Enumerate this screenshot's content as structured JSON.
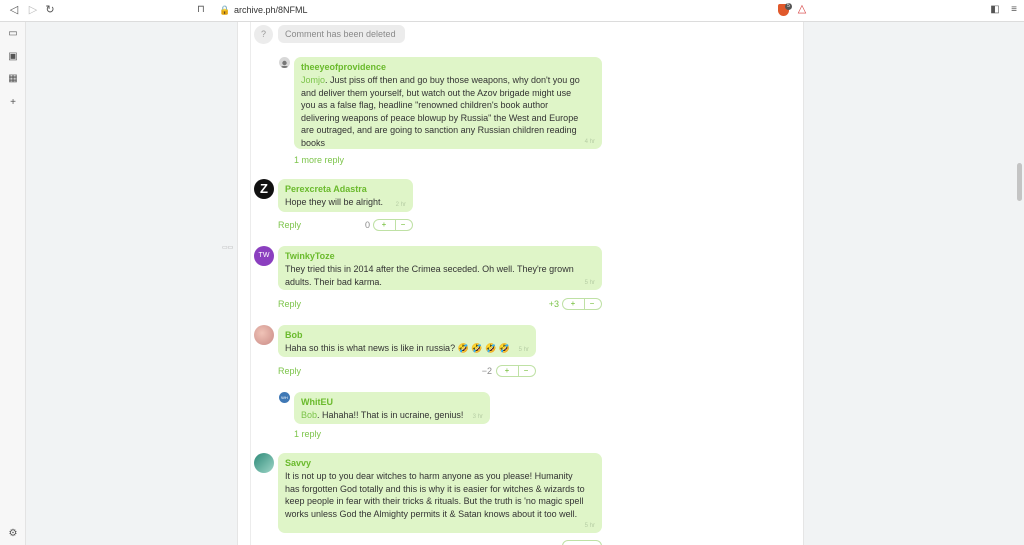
{
  "browser": {
    "url": "archive.ph/8NFML",
    "extension_badge": "5"
  },
  "comments": {
    "deleted_placeholder": {
      "avatar_text": "?",
      "text": "Comment has been deleted"
    },
    "c1": {
      "author": "theeyeofprovidence",
      "mention": "Jomjo",
      "lines": [
        ". Just piss off then and go buy those weapons, why don't you go",
        "and deliver them yourself, but watch out the Azov brigade might use",
        "you as a false flag, headline \"renowned children's book author",
        "delivering weapons of peace blowup by Russia\" the West and Europe",
        "are outraged, and are going to sanction any Russian children reading",
        "books"
      ],
      "time": "4 hr",
      "more_replies": "1 more reply"
    },
    "c2": {
      "author": "Perexcreta Adastra",
      "avatar_text": "Z",
      "text": "Hope they will be alright.",
      "time": "2 hr",
      "reply_label": "Reply",
      "score": "0",
      "upvote": "+",
      "downvote": "−"
    },
    "c3": {
      "author": "TwinkyToze",
      "avatar_text": "TW",
      "avatar_color": "#8b3fbf",
      "lines": [
        "They tried this in 2014 after the Crimea seceded. Oh well. They're grown",
        "adults. Their bad karma."
      ],
      "time": "5 hr",
      "reply_label": "Reply",
      "score": "+3",
      "upvote": "+",
      "downvote": "−"
    },
    "c4": {
      "author": "Bob",
      "text": "Haha so this is what news is like in russia? 🤣 🤣 🤣 🤣",
      "time": "5 hr",
      "reply_label": "Reply",
      "score": "−2",
      "upvote": "+",
      "downvote": "−"
    },
    "c5": {
      "author": "WhitEU",
      "avatar_text": "WH",
      "mention": "Bob",
      "text": ". Hahaha!! That is in ucraine, genius!",
      "time": "3 hr",
      "replies": "1 reply"
    },
    "c6": {
      "author": "Savvy",
      "lines": [
        "It is not up to you dear witches to harm anyone as you please! Humanity",
        "has forgotten God totally and this is why it is easier for witches & wizards to",
        "keep people in fear with their tricks & rituals. But the truth is 'no magic spell",
        "works unless God the Almighty permits it & Satan knows about it too well."
      ],
      "time": "5 hr"
    }
  },
  "colors": {
    "bubble": "#dff5c8",
    "author": "#6aba2c",
    "link": "#7cc44a"
  }
}
